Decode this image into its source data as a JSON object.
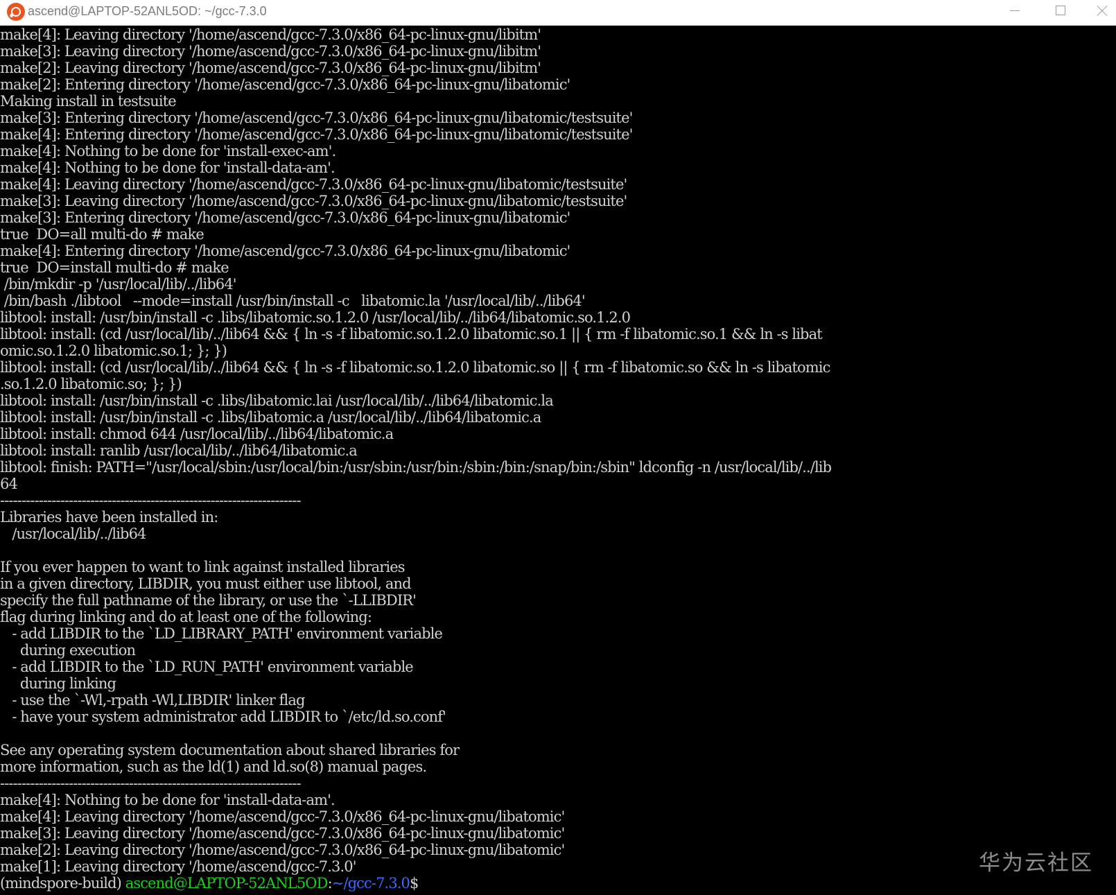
{
  "window": {
    "title": "ascend@LAPTOP-52ANL5OD: ~/gcc-7.3.0",
    "app_icon": "ubuntu-icon",
    "controls": [
      "minimize-icon",
      "maximize-icon",
      "close-icon"
    ]
  },
  "terminal": {
    "lines": [
      "make[4]: Leaving directory '/home/ascend/gcc-7.3.0/x86_64-pc-linux-gnu/libitm'",
      "make[3]: Leaving directory '/home/ascend/gcc-7.3.0/x86_64-pc-linux-gnu/libitm'",
      "make[2]: Leaving directory '/home/ascend/gcc-7.3.0/x86_64-pc-linux-gnu/libitm'",
      "make[2]: Entering directory '/home/ascend/gcc-7.3.0/x86_64-pc-linux-gnu/libatomic'",
      "Making install in testsuite",
      "make[3]: Entering directory '/home/ascend/gcc-7.3.0/x86_64-pc-linux-gnu/libatomic/testsuite'",
      "make[4]: Entering directory '/home/ascend/gcc-7.3.0/x86_64-pc-linux-gnu/libatomic/testsuite'",
      "make[4]: Nothing to be done for 'install-exec-am'.",
      "make[4]: Nothing to be done for 'install-data-am'.",
      "make[4]: Leaving directory '/home/ascend/gcc-7.3.0/x86_64-pc-linux-gnu/libatomic/testsuite'",
      "make[3]: Leaving directory '/home/ascend/gcc-7.3.0/x86_64-pc-linux-gnu/libatomic/testsuite'",
      "make[3]: Entering directory '/home/ascend/gcc-7.3.0/x86_64-pc-linux-gnu/libatomic'",
      "true  DO=all multi-do # make",
      "make[4]: Entering directory '/home/ascend/gcc-7.3.0/x86_64-pc-linux-gnu/libatomic'",
      "true  DO=install multi-do # make",
      " /bin/mkdir -p '/usr/local/lib/../lib64'",
      " /bin/bash ./libtool   --mode=install /usr/bin/install -c   libatomic.la '/usr/local/lib/../lib64'",
      "libtool: install: /usr/bin/install -c .libs/libatomic.so.1.2.0 /usr/local/lib/../lib64/libatomic.so.1.2.0",
      "libtool: install: (cd /usr/local/lib/../lib64 && { ln -s -f libatomic.so.1.2.0 libatomic.so.1 || { rm -f libatomic.so.1 && ln -s libat",
      "omic.so.1.2.0 libatomic.so.1; }; })",
      "libtool: install: (cd /usr/local/lib/../lib64 && { ln -s -f libatomic.so.1.2.0 libatomic.so || { rm -f libatomic.so && ln -s libatomic",
      ".so.1.2.0 libatomic.so; }; })",
      "libtool: install: /usr/bin/install -c .libs/libatomic.lai /usr/local/lib/../lib64/libatomic.la",
      "libtool: install: /usr/bin/install -c .libs/libatomic.a /usr/local/lib/../lib64/libatomic.a",
      "libtool: install: chmod 644 /usr/local/lib/../lib64/libatomic.a",
      "libtool: install: ranlib /usr/local/lib/../lib64/libatomic.a",
      "libtool: finish: PATH=\"/usr/local/sbin:/usr/local/bin:/usr/sbin:/usr/bin:/sbin:/bin:/snap/bin:/sbin\" ldconfig -n /usr/local/lib/../lib",
      "64",
      "----------------------------------------------------------------------",
      "Libraries have been installed in:",
      "   /usr/local/lib/../lib64",
      "",
      "If you ever happen to want to link against installed libraries",
      "in a given directory, LIBDIR, you must either use libtool, and",
      "specify the full pathname of the library, or use the `-LLIBDIR'",
      "flag during linking and do at least one of the following:",
      "   - add LIBDIR to the `LD_LIBRARY_PATH' environment variable",
      "     during execution",
      "   - add LIBDIR to the `LD_RUN_PATH' environment variable",
      "     during linking",
      "   - use the `-Wl,-rpath -Wl,LIBDIR' linker flag",
      "   - have your system administrator add LIBDIR to `/etc/ld.so.conf'",
      "",
      "See any operating system documentation about shared libraries for",
      "more information, such as the ld(1) and ld.so(8) manual pages.",
      "----------------------------------------------------------------------",
      "make[4]: Nothing to be done for 'install-data-am'.",
      "make[4]: Leaving directory '/home/ascend/gcc-7.3.0/x86_64-pc-linux-gnu/libatomic'",
      "make[3]: Leaving directory '/home/ascend/gcc-7.3.0/x86_64-pc-linux-gnu/libatomic'",
      "make[2]: Leaving directory '/home/ascend/gcc-7.3.0/x86_64-pc-linux-gnu/libatomic'",
      "make[1]: Leaving directory '/home/ascend/gcc-7.3.0'"
    ],
    "prompt": {
      "env": "(mindspore-build) ",
      "user_host": "ascend@LAPTOP-52ANL5OD",
      "colon": ":",
      "path": "~/gcc-7.3.0",
      "symbol": "$"
    },
    "colors": {
      "background": "#000000",
      "text": "#d2d2d2",
      "prompt_user": "#1bd01b",
      "prompt_path": "#3a6cff"
    }
  },
  "watermark": "华为云社区"
}
